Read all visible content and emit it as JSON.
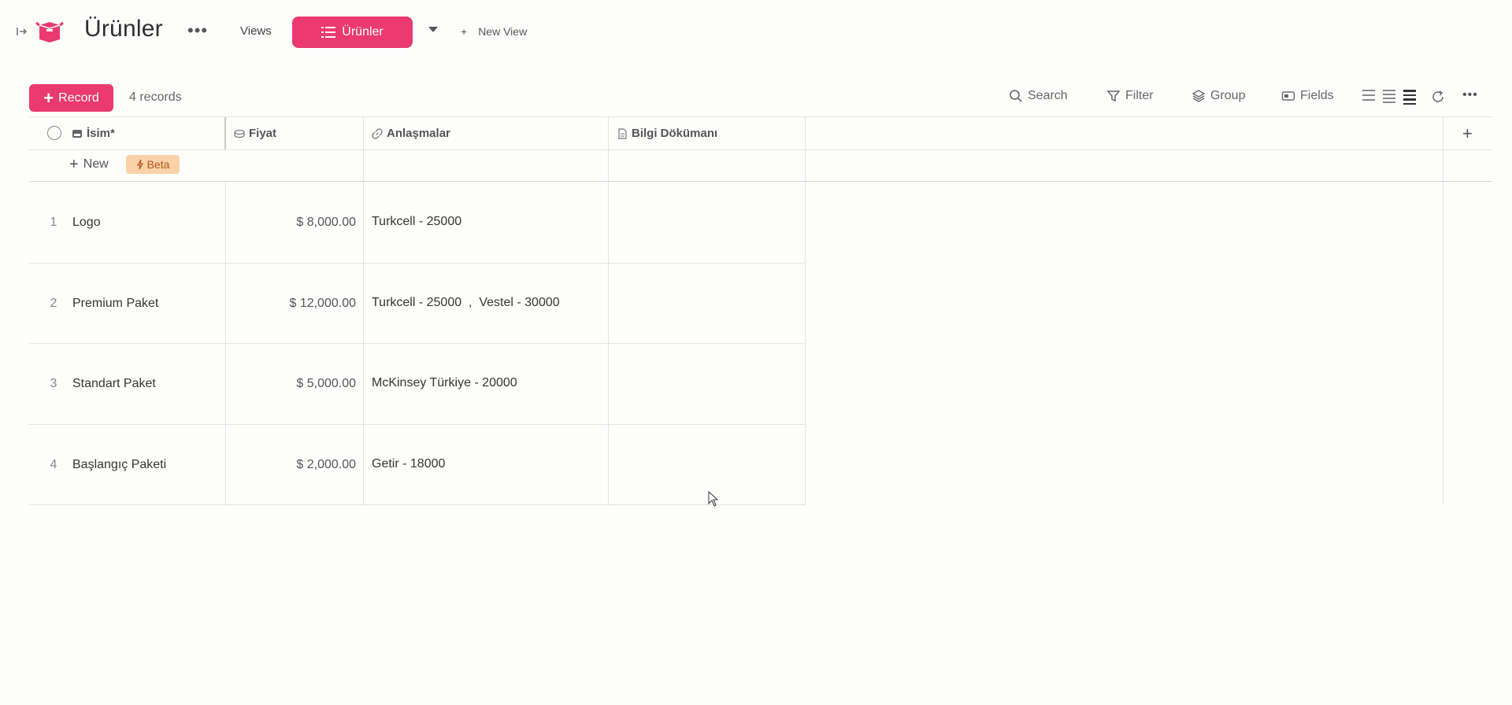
{
  "header": {
    "title": "Ürünler",
    "views_label": "Views",
    "active_view": "Ürünler",
    "new_view_plus": "+",
    "new_view_label": "New View"
  },
  "toolbar": {
    "record_label": "Record",
    "record_count": "4 records",
    "search_label": "Search",
    "filter_label": "Filter",
    "group_label": "Group",
    "fields_label": "Fields"
  },
  "table": {
    "columns": [
      "İsim*",
      "Fiyat",
      "Anlaşmalar",
      "Bilgi Dökümanı"
    ],
    "new_row_label": "New",
    "beta_label": "Beta",
    "rows": [
      {
        "num": "1",
        "name": "Logo",
        "price": "$ 8,000.00",
        "deals": "Turkcell - 25000"
      },
      {
        "num": "2",
        "name": "Premium Paket",
        "price": "$ 12,000.00",
        "deals": "Turkcell - 25000  ,  Vestel - 30000"
      },
      {
        "num": "3",
        "name": "Standart Paket",
        "price": "$ 5,000.00",
        "deals": "McKinsey Türkiye - 20000"
      },
      {
        "num": "4",
        "name": "Başlangıç Paketi",
        "price": "$ 2,000.00",
        "deals": "Getir - 18000"
      }
    ]
  },
  "colors": {
    "accent": "#ea3a6f",
    "beta_bg": "#fbd2a8"
  }
}
